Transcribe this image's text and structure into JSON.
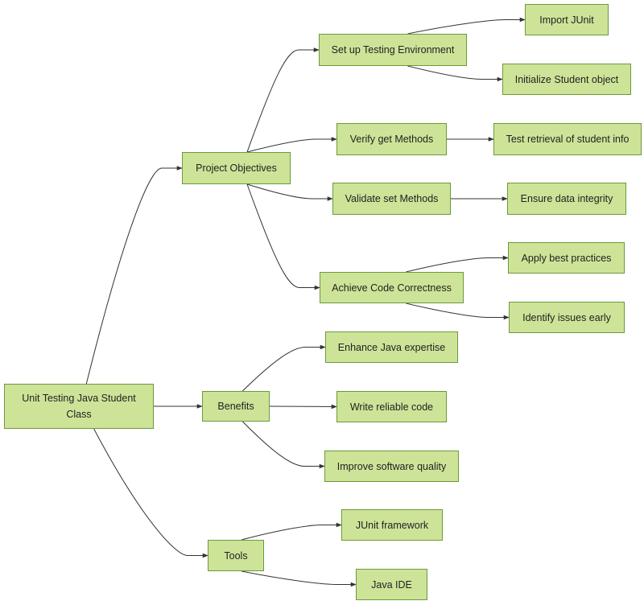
{
  "diagram": {
    "type": "mindmap-flowchart",
    "colors": {
      "node_fill": "#cde498",
      "node_border": "#6b9a3a",
      "edge": "#333333",
      "text": "#222222"
    },
    "nodes": [
      {
        "id": "root",
        "label": "Unit Testing Java Student Class"
      },
      {
        "id": "objectives",
        "label": "Project Objectives"
      },
      {
        "id": "setup",
        "label": "Set up Testing Environment"
      },
      {
        "id": "import_junit",
        "label": "Import JUnit"
      },
      {
        "id": "init_student",
        "label": "Initialize Student object"
      },
      {
        "id": "verify_get",
        "label": "Verify get Methods"
      },
      {
        "id": "test_retrieval",
        "label": "Test retrieval of student info"
      },
      {
        "id": "validate_set",
        "label": "Validate set Methods"
      },
      {
        "id": "ensure_integrity",
        "label": "Ensure data integrity"
      },
      {
        "id": "achieve",
        "label": "Achieve Code Correctness"
      },
      {
        "id": "best_practices",
        "label": "Apply best practices"
      },
      {
        "id": "identify_issues",
        "label": "Identify issues early"
      },
      {
        "id": "benefits",
        "label": "Benefits"
      },
      {
        "id": "enhance_java",
        "label": "Enhance Java expertise"
      },
      {
        "id": "write_reliable",
        "label": "Write reliable code"
      },
      {
        "id": "improve_quality",
        "label": "Improve software quality"
      },
      {
        "id": "tools",
        "label": "Tools"
      },
      {
        "id": "junit_framework",
        "label": "JUnit framework"
      },
      {
        "id": "java_ide",
        "label": "Java IDE"
      }
    ],
    "edges": [
      {
        "from": "root",
        "to": "objectives"
      },
      {
        "from": "root",
        "to": "benefits"
      },
      {
        "from": "root",
        "to": "tools"
      },
      {
        "from": "objectives",
        "to": "setup"
      },
      {
        "from": "objectives",
        "to": "verify_get"
      },
      {
        "from": "objectives",
        "to": "validate_set"
      },
      {
        "from": "objectives",
        "to": "achieve"
      },
      {
        "from": "setup",
        "to": "import_junit"
      },
      {
        "from": "setup",
        "to": "init_student"
      },
      {
        "from": "verify_get",
        "to": "test_retrieval"
      },
      {
        "from": "validate_set",
        "to": "ensure_integrity"
      },
      {
        "from": "achieve",
        "to": "best_practices"
      },
      {
        "from": "achieve",
        "to": "identify_issues"
      },
      {
        "from": "benefits",
        "to": "enhance_java"
      },
      {
        "from": "benefits",
        "to": "write_reliable"
      },
      {
        "from": "benefits",
        "to": "improve_quality"
      },
      {
        "from": "tools",
        "to": "junit_framework"
      },
      {
        "from": "tools",
        "to": "java_ide"
      }
    ]
  }
}
